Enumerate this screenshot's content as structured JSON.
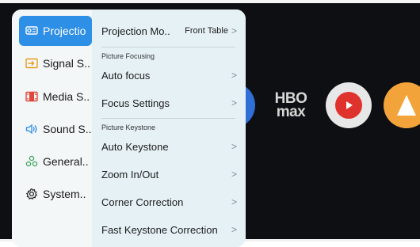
{
  "sidebar": {
    "items": [
      {
        "label": "Projectio",
        "icon": "projector-icon",
        "active": true
      },
      {
        "label": "Signal S..",
        "icon": "input-source-icon",
        "active": false
      },
      {
        "label": "Media S..",
        "icon": "film-icon",
        "active": false
      },
      {
        "label": "Sound S..",
        "icon": "speaker-icon",
        "active": false
      },
      {
        "label": "General..",
        "icon": "general-settings-icon",
        "active": false
      },
      {
        "label": "System..",
        "icon": "gear-icon",
        "active": false
      }
    ]
  },
  "content": {
    "projection_mode": {
      "label": "Projection Mo..",
      "value": "Front Table"
    },
    "section_focusing": "Picture Focusing",
    "auto_focus": "Auto focus",
    "focus_settings": "Focus Settings",
    "section_keystone": "Picture Keystone",
    "auto_keystone": "Auto Keystone",
    "zoom": "Zoom In/Out",
    "corner_correction": "Corner Correction",
    "fast_keystone": "Fast Keystone Correction",
    "chevron": ">"
  },
  "background_apps": {
    "hbo_line1": "HBO",
    "hbo_line2": "max"
  },
  "colors": {
    "accent": "#2e8fe6",
    "panel": "#e6f1f6",
    "screen": "#0e0f12"
  }
}
